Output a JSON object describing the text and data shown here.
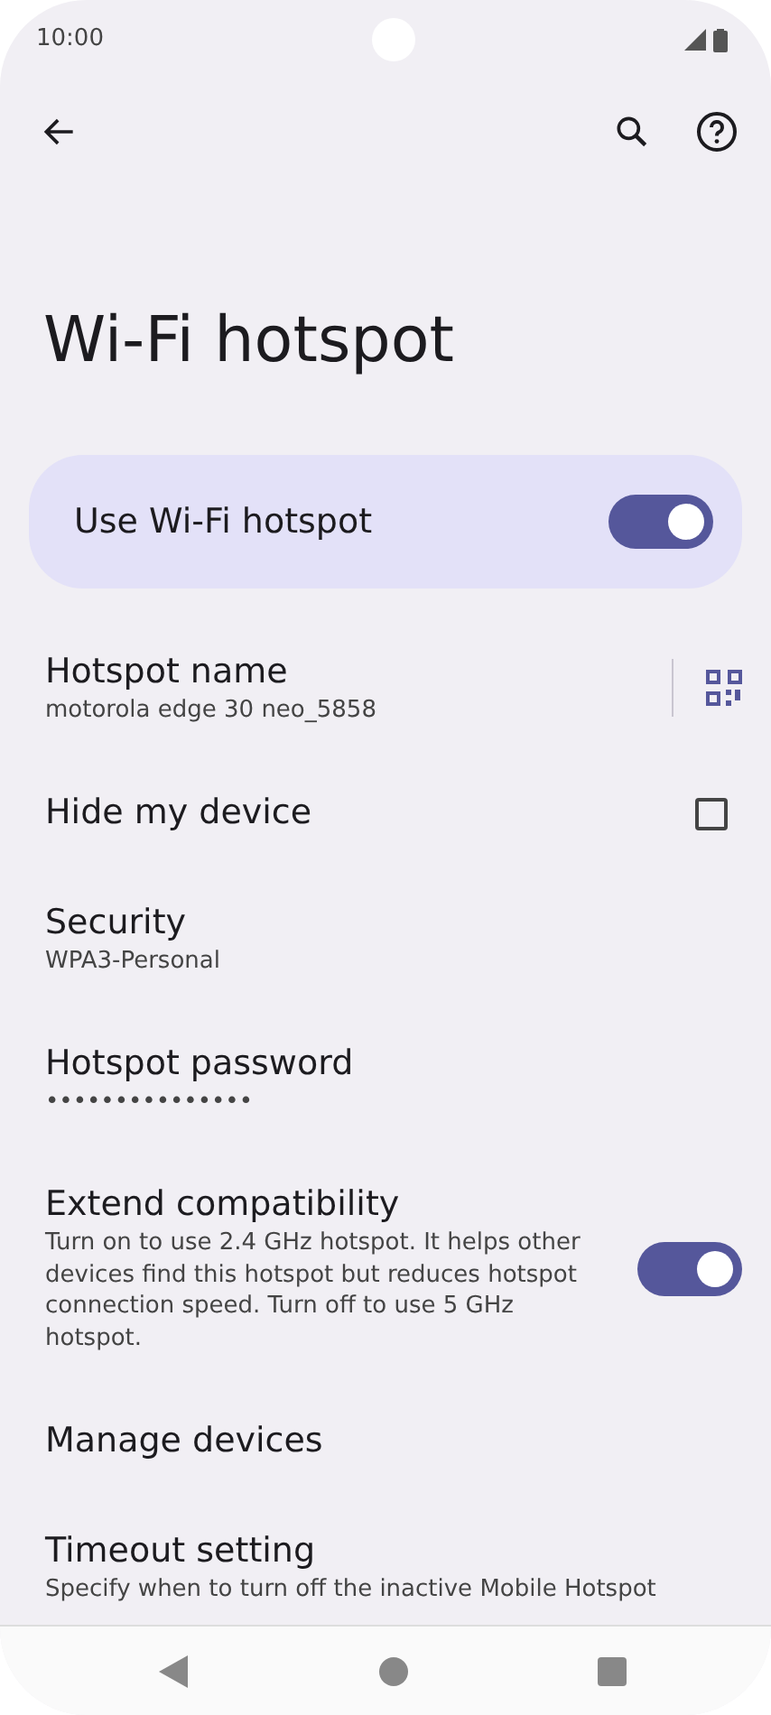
{
  "status_bar": {
    "time": "10:00"
  },
  "page_title": "Wi-Fi hotspot",
  "main_switch": {
    "label": "Use Wi-Fi hotspot",
    "on": true
  },
  "settings": [
    {
      "kind": "qr",
      "title": "Hotspot name",
      "summary": "motorola edge 30 neo_5858"
    },
    {
      "kind": "checkbox",
      "title": "Hide my device",
      "checked": false
    },
    {
      "kind": "text",
      "title": "Security",
      "summary": "WPA3-Personal"
    },
    {
      "kind": "text",
      "title": "Hotspot password",
      "summary": "•••••••••••••••"
    },
    {
      "kind": "switch",
      "title": "Extend compatibility",
      "summary": "Turn on to use 2.4 GHz hotspot. It helps other devices find this hotspot but reduces hotspot connection speed. Turn off to use 5 GHz hotspot.",
      "on": true
    },
    {
      "kind": "text",
      "title": "Manage devices"
    },
    {
      "kind": "text",
      "title": "Timeout setting",
      "summary": "Specify when to turn off the inactive Mobile Hotspot"
    }
  ]
}
